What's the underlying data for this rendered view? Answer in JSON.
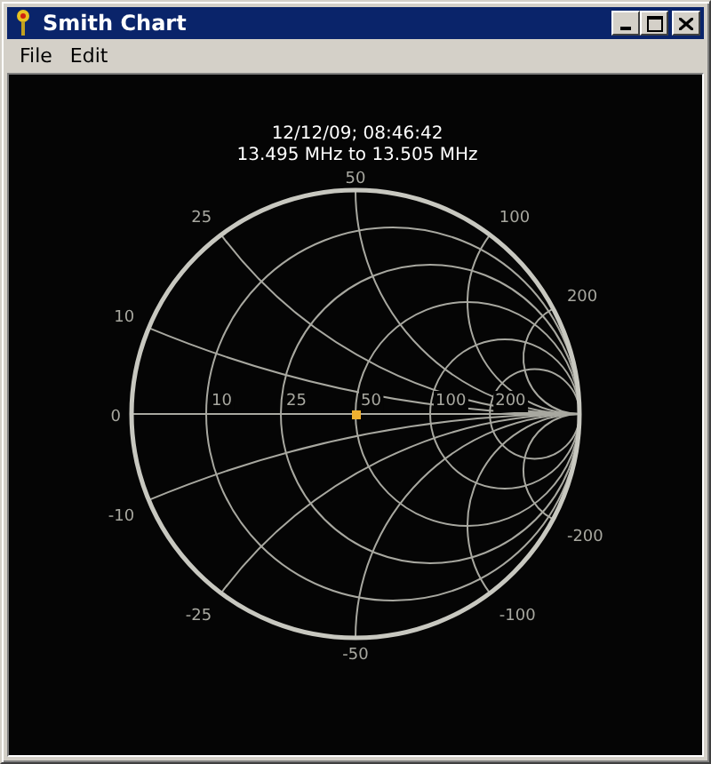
{
  "window": {
    "title": "Smith Chart"
  },
  "menu": [
    {
      "label": "File"
    },
    {
      "label": "Edit"
    }
  ],
  "chart": {
    "timestamp": "12/12/09; 08:46:42",
    "frequency_range": "13.495 MHz to 13.505 MHz",
    "resistance_labels": [
      "10",
      "25",
      "50",
      "100",
      "200"
    ],
    "reactance_zero_label": "0",
    "reactance_labels_upper": [
      "10",
      "25",
      "50",
      "100",
      "200"
    ],
    "reactance_labels_lower": [
      "-10",
      "-25",
      "-50",
      "-100",
      "-200"
    ]
  }
}
